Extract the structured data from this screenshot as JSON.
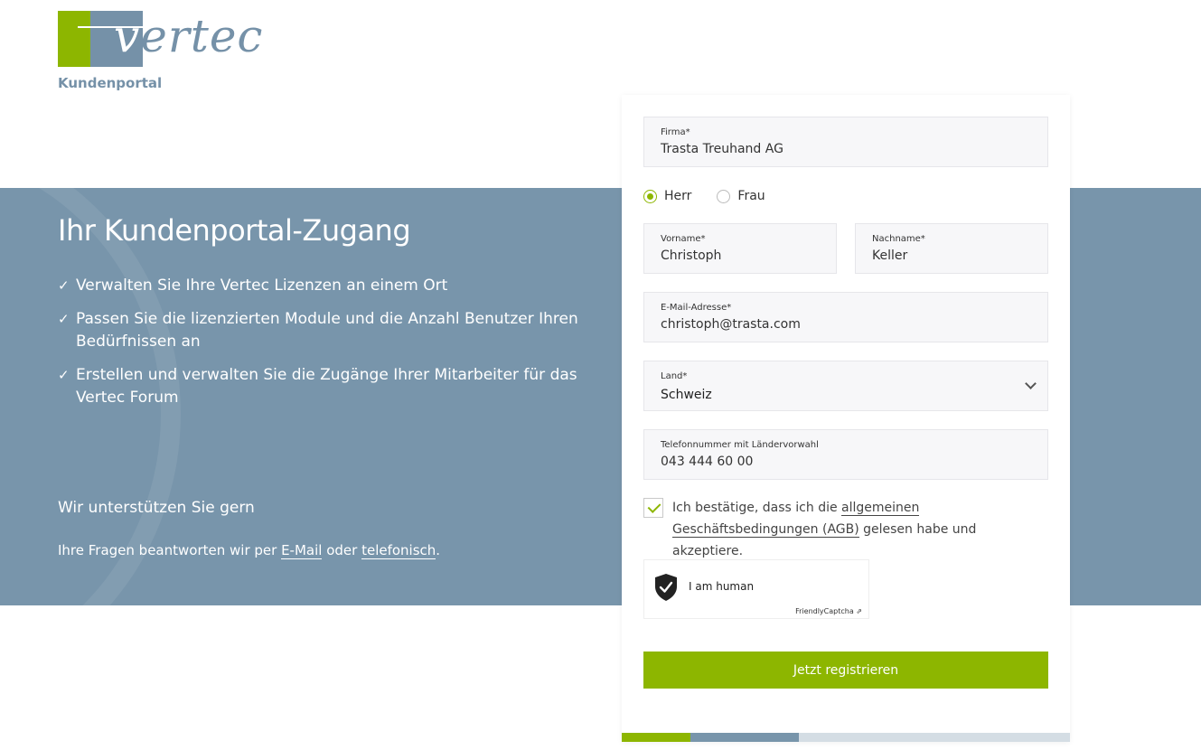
{
  "logo": {
    "wordmark_v": "v",
    "wordmark_rest": "ertec",
    "portal_label": "Kundenportal"
  },
  "hero": {
    "title": "Ihr Kundenportal-Zugang",
    "benefits": [
      "Verwalten Sie Ihre Vertec Lizenzen an einem Ort",
      "Passen Sie die lizenzierten Module und die Anzahl Benutzer Ihren Bedürfnissen an",
      "Erstellen und verwalten Sie die Zugänge Ihrer Mitarbeiter für das Vertec Forum"
    ],
    "check_glyph": "✓",
    "support_title": "Wir unterstützen Sie gern",
    "support_prefix": "Ihre Fragen beantworten wir per ",
    "support_email_link": "E-Mail",
    "support_middle": " oder ",
    "support_phone_link": "telefonisch",
    "support_suffix": "."
  },
  "form": {
    "company": {
      "label": "Firma*",
      "value": "Trasta Treuhand AG"
    },
    "salutation": {
      "options": [
        "Herr",
        "Frau"
      ],
      "selected": "Herr"
    },
    "firstname": {
      "label": "Vorname*",
      "value": "Christoph"
    },
    "lastname": {
      "label": "Nachname*",
      "value": "Keller"
    },
    "email": {
      "label": "E-Mail-Adresse*",
      "value": "christoph@trasta.com"
    },
    "country": {
      "label": "Land*",
      "value": "Schweiz"
    },
    "phone": {
      "label": "Telefonnummer mit Ländervorwahl",
      "value": "043 444 60 00"
    },
    "agb": {
      "checked": true,
      "prefix": "Ich bestätige, dass ich die ",
      "link": "allgemeinen Geschäftsbedingungen (AGB)",
      "suffix": " gelesen habe und akzeptiere."
    },
    "captcha": {
      "label": "I am human",
      "brand": "FriendlyCaptcha ⇗"
    },
    "submit_label": "Jetzt registrieren"
  },
  "colors": {
    "accent": "#8db600",
    "brand_blue": "#7895ab"
  },
  "icons": [
    "check-icon",
    "chevron-down-icon",
    "shield-check-icon"
  ]
}
